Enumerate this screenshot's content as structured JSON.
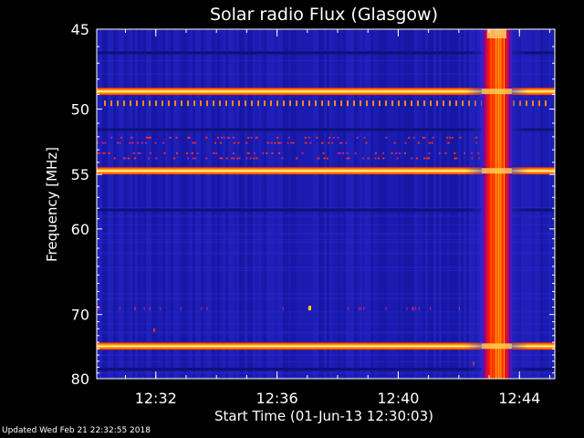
{
  "chart_data": {
    "type": "heatmap",
    "title": "Solar radio Flux (Glasgow)",
    "xlabel": "Start Time (01-Jun-13 12:30:03)",
    "ylabel": "Frequency [MHz]",
    "x_unit": "time",
    "xlim": [
      "12:30:03",
      "12:45:10"
    ],
    "ylim": [
      45,
      80
    ],
    "y_scale": "reciprocal",
    "x_ticks": [
      "12:32",
      "12:36",
      "12:40",
      "12:44"
    ],
    "y_ticks": [
      45,
      50,
      55,
      60,
      70,
      80
    ],
    "background_color": "#1a1ab0",
    "colormap": [
      "#000000",
      "#1a1ab0",
      "#ff2000",
      "#ffa000",
      "#ffffff"
    ],
    "burst": {
      "start": "12:42:45",
      "end": "12:43:45",
      "freq_range": [
        45,
        80
      ]
    },
    "bright_bands_mhz": [
      48.8,
      54.7,
      74.6
    ],
    "dark_bands_mhz": [
      46.4,
      51.5,
      58.2,
      78.4
    ]
  },
  "footer": {
    "updated": "Updated Wed Feb 21 22:32:55 2018"
  }
}
